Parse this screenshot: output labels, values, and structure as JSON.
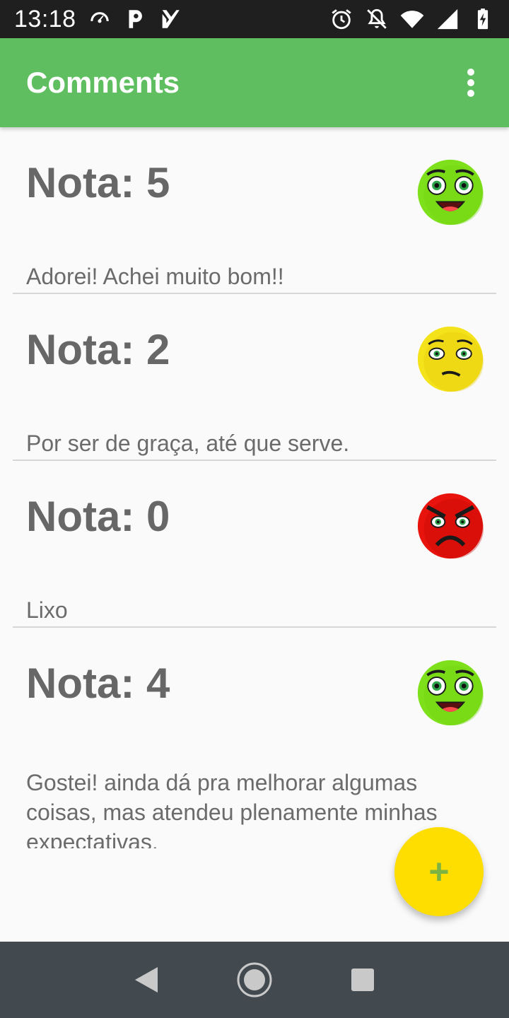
{
  "status_bar": {
    "time": "13:18",
    "left_icons": [
      "speedometer-icon",
      "p-icon",
      "check-badge-icon"
    ],
    "right_icons": [
      "alarm-icon",
      "notifications-off-icon",
      "wifi-icon",
      "signal-icon",
      "battery-charging-icon"
    ]
  },
  "app_bar": {
    "title": "Comments",
    "menu_icon": "more-vert-icon",
    "color": "#5fbf60"
  },
  "comments": [
    {
      "rating_label": "Nota: 5",
      "text": "Adorei! Achei muito bom!!",
      "face": "happy",
      "face_color": "#7ee01a"
    },
    {
      "rating_label": "Nota: 2",
      "text": "Por ser de graça, até que serve.",
      "face": "meh",
      "face_color": "#f4e21a"
    },
    {
      "rating_label": "Nota: 0",
      "text": "Lixo",
      "face": "angry",
      "face_color": "#e8130c"
    },
    {
      "rating_label": "Nota: 4",
      "text": "Gostei! ainda dá pra melhorar algumas coisas, mas atendeu plenamente minhas expectativas.",
      "face": "happy",
      "face_color": "#7ee01a"
    }
  ],
  "fab": {
    "label": "+",
    "color": "#fdde00"
  },
  "nav_bar": {
    "buttons": [
      "back-icon",
      "home-icon",
      "recents-icon"
    ]
  }
}
